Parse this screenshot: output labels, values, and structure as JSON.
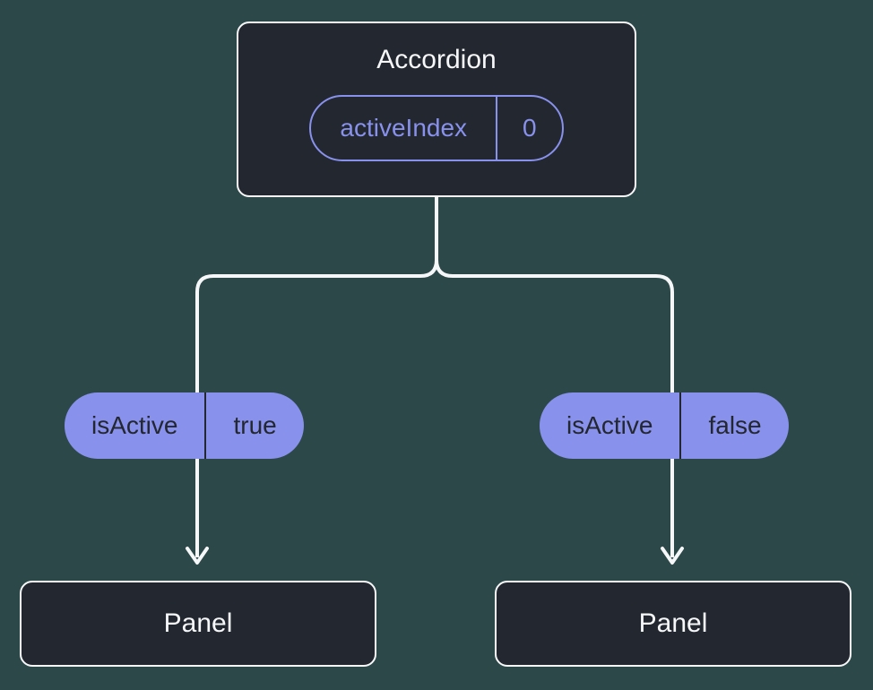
{
  "parent": {
    "title": "Accordion",
    "state_name": "activeIndex",
    "state_value": "0"
  },
  "children": [
    {
      "prop_name": "isActive",
      "prop_value": "true",
      "label": "Panel"
    },
    {
      "prop_name": "isActive",
      "prop_value": "false",
      "label": "Panel"
    }
  ]
}
